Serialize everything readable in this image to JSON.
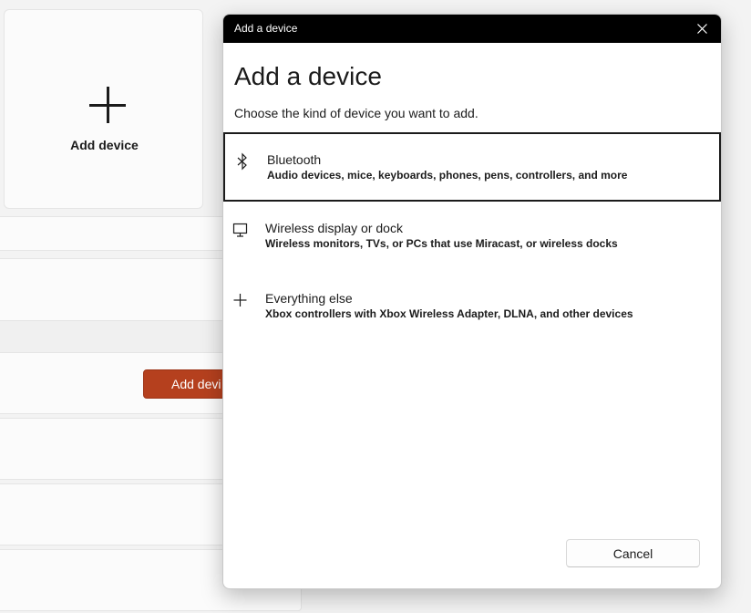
{
  "background": {
    "tile_label": "Add device",
    "add_button_label": "Add devi"
  },
  "dialog": {
    "title": "Add a device",
    "heading": "Add a device",
    "subtitle": "Choose the kind of device you want to add.",
    "options": [
      {
        "icon": "bluetooth-icon",
        "title": "Bluetooth",
        "description": "Audio devices, mice, keyboards, phones, pens, controllers, and more"
      },
      {
        "icon": "monitor-icon",
        "title": "Wireless display or dock",
        "description": "Wireless monitors, TVs, or PCs that use Miracast, or wireless docks"
      },
      {
        "icon": "plus-icon",
        "title": "Everything else",
        "description": "Xbox controllers with Xbox Wireless Adapter, DLNA, and other devices"
      }
    ],
    "cancel_label": "Cancel"
  },
  "colors": {
    "accent": "#b5401e",
    "titlebar": "#000000"
  }
}
